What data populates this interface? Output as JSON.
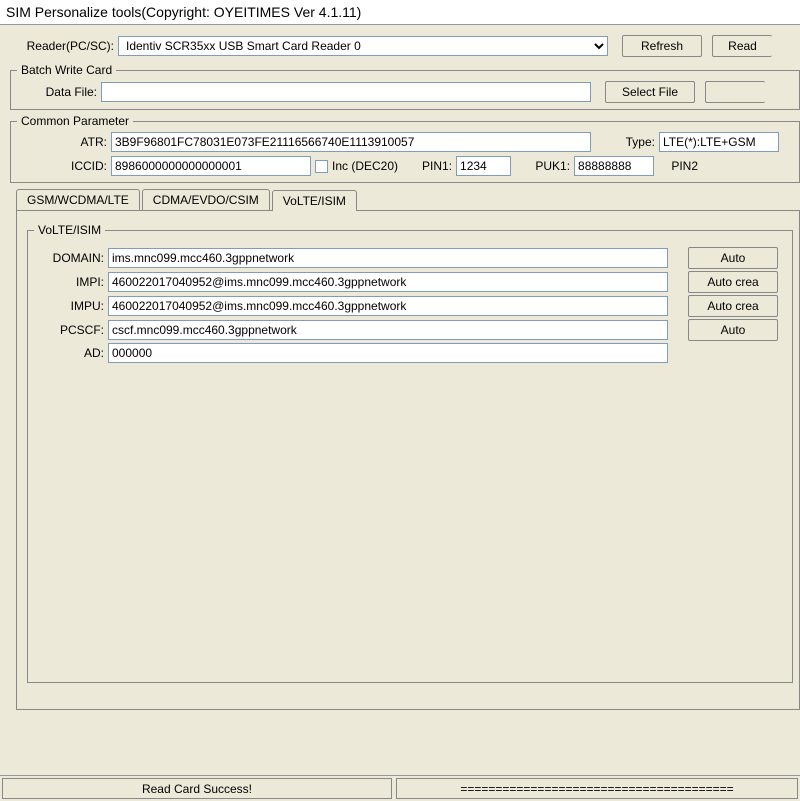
{
  "window": {
    "title": "SIM Personalize tools(Copyright: OYEITIMES Ver 4.1.11)"
  },
  "reader": {
    "label": "Reader(PC/SC):",
    "value": "Identiv SCR35xx USB Smart Card Reader 0",
    "refresh": "Refresh",
    "read": "Read"
  },
  "batch": {
    "legend": "Batch Write Card",
    "datafile_label": "Data File:",
    "datafile_value": "",
    "select_file": "Select File",
    "extra_button": ""
  },
  "common": {
    "legend": "Common Parameter",
    "atr_label": "ATR:",
    "atr_value": "3B9F96801FC78031E073FE21116566740E1113910057",
    "type_label": "Type:",
    "type_value": "LTE(*):LTE+GSM",
    "iccid_label": "ICCID:",
    "iccid_value": "8986000000000000001",
    "inc_label": "Inc  (DEC20)",
    "pin1_label": "PIN1:",
    "pin1_value": "1234",
    "puk1_label": "PUK1:",
    "puk1_value": "88888888",
    "pin2_label": "PIN2"
  },
  "tabs": {
    "gsm": "GSM/WCDMA/LTE",
    "cdma": "CDMA/EVDO/CSIM",
    "volte": "VoLTE/ISIM"
  },
  "volte": {
    "legend": "VoLTE/ISIM",
    "domain_label": "DOMAIN:",
    "domain_value": "ims.mnc099.mcc460.3gppnetwork",
    "impi_label": "IMPI:",
    "impi_value": "460022017040952@ims.mnc099.mcc460.3gppnetwork",
    "impu_label": "IMPU:",
    "impu_value": "460022017040952@ims.mnc099.mcc460.3gppnetwork",
    "pcscf_label": "PCSCF:",
    "pcscf_value": "cscf.mnc099.mcc460.3gppnetwork",
    "ad_label": "AD:",
    "ad_value": "000000",
    "btn_auto1": "Auto",
    "btn_auto2": "Auto crea",
    "btn_auto3": "Auto crea",
    "btn_auto4": "Auto"
  },
  "status": {
    "left": "Read Card Success!",
    "right": "======================================="
  }
}
